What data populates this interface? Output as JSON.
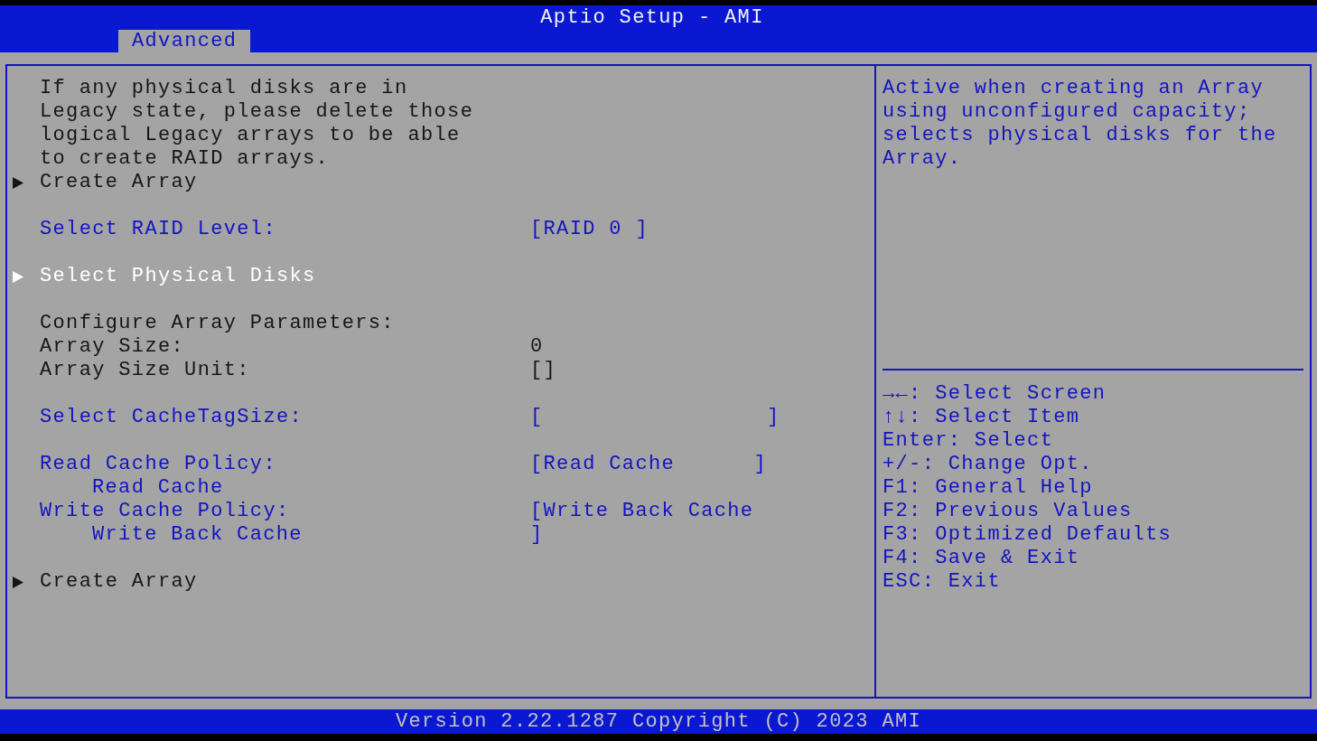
{
  "title": "Aptio Setup - AMI",
  "tabs": [
    {
      "label": "Advanced",
      "selected": true
    }
  ],
  "menu": {
    "sections": [
      {
        "items": [
          {
            "kind": "note",
            "text": "If any physical disks are in Legacy state, please delete those logical Legacy arrays to be able to create RAID arrays.",
            "selected": false
          },
          {
            "kind": "submenu",
            "label": "Create Array",
            "selected": false
          }
        ]
      },
      {
        "items": [
          {
            "kind": "option",
            "label": "Select RAID Level:",
            "value": "[RAID 0 ]",
            "selected": false
          }
        ]
      },
      {
        "items": [
          {
            "kind": "submenu",
            "label": "Select Physical Disks",
            "selected": true
          }
        ]
      },
      {
        "items": [
          {
            "kind": "heading",
            "label": "Configure Array Parameters:",
            "selected": false
          },
          {
            "kind": "info",
            "label": "Array Size:",
            "value": "0",
            "selected": false
          },
          {
            "kind": "info",
            "label": "Array Size Unit:",
            "value": "[]",
            "selected": false
          }
        ]
      },
      {
        "items": [
          {
            "kind": "option",
            "label": "Select CacheTagSize:",
            "value": "[                 ]",
            "selected": false
          }
        ]
      },
      {
        "items": [
          {
            "kind": "option",
            "label": "Read Cache Policy:",
            "value": "[Read Cache      ]",
            "detail": "Read Cache",
            "selected": false
          },
          {
            "kind": "option",
            "label": "Write Cache Policy:",
            "value": "[Write Back Cache\n]",
            "detail": "Write Back Cache",
            "selected": false
          }
        ]
      },
      {
        "items": [
          {
            "kind": "submenu",
            "label": "Create Array",
            "selected": false
          }
        ]
      }
    ]
  },
  "help": {
    "text": "Active when creating an Array using unconfigured capacity; selects physical disks for the Array.",
    "keys": [
      "→←: Select Screen",
      "↑↓: Select Item",
      "Enter: Select",
      "+/-: Change Opt.",
      "F1: General Help",
      "F2: Previous Values",
      "F3: Optimized Defaults",
      "F4: Save & Exit",
      "ESC: Exit"
    ]
  },
  "status_bar": "Version 2.22.1287 Copyright (C) 2023 AMI"
}
